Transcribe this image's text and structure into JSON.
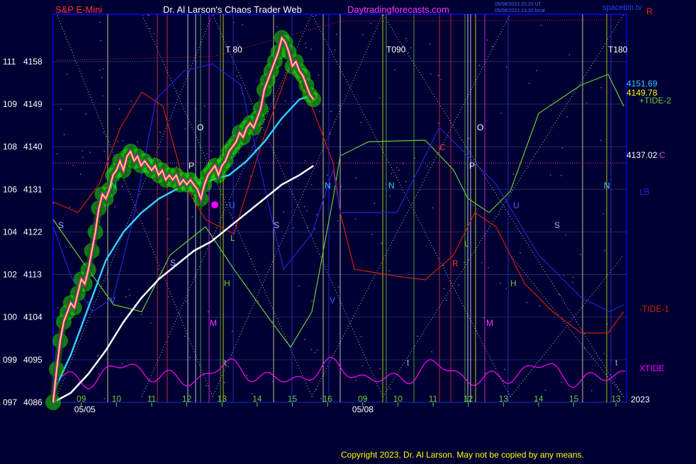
{
  "header": {
    "left_title": "S&P E-Mini",
    "center_title": "Dr. Al Larson's Chaos Trader Web",
    "site": "Daytradingforecasts.com",
    "timestamp_1": "05/08/2023 20:20 UT",
    "timestamp_2": "05/08/2023 13:20 local",
    "corner_right": "R",
    "corner_site": "spacetim.tv"
  },
  "footer": {
    "copyright": "Copyright 2023, Dr. Al Larson. May not be copied by any means."
  },
  "colors": {
    "background": "#000033",
    "plot_border": "#0000ff",
    "price": "#ffff00",
    "price_inner": "#ff00ff",
    "price_glow": "#22dd00",
    "cyan_ma": "#33ccff",
    "white_ma": "#ffffff",
    "tide2": "#66cc33",
    "tide1": "#cc2200",
    "xtide": "#ff00ff",
    "lb": "#2222dd",
    "c_line": "#cc44cc"
  },
  "chart_data": {
    "type": "line",
    "title": "S&P E-Mini",
    "y_tick_labels": [
      {
        "left": "097",
        "price": 4086
      },
      {
        "left": "099",
        "price": 4095
      },
      {
        "left": "100",
        "price": 4104
      },
      {
        "left": "102",
        "price": 4113
      },
      {
        "left": "104",
        "price": 4122
      },
      {
        "left": "106",
        "price": 4131
      },
      {
        "left": "108",
        "price": 4140
      },
      {
        "left": "109",
        "price": 4149
      },
      {
        "left": "111",
        "price": 4158
      }
    ],
    "y_range": [
      4086,
      4168
    ],
    "x_ticks": [
      {
        "label": "09",
        "t": 0.3
      },
      {
        "label": "10",
        "t": 1.3
      },
      {
        "label": "11",
        "t": 2.3
      },
      {
        "label": "12",
        "t": 3.3
      },
      {
        "label": "13",
        "t": 4.3
      },
      {
        "label": "14",
        "t": 5.3
      },
      {
        "label": "15",
        "t": 6.3
      },
      {
        "label": "16",
        "t": 7.3
      },
      {
        "label": "09",
        "t": 8.3
      },
      {
        "label": "10",
        "t": 9.3
      },
      {
        "label": "11",
        "t": 10.3
      },
      {
        "label": "12",
        "t": 11.3
      },
      {
        "label": "13",
        "t": 12.3
      },
      {
        "label": "14",
        "t": 13.3
      },
      {
        "label": "15",
        "t": 14.3
      },
      {
        "label": "13",
        "t": 15.5
      }
    ],
    "x_range": [
      -0.5,
      15.8
    ],
    "date_labels": [
      {
        "label": "05/05",
        "t": 0.0
      },
      {
        "label": "05/08",
        "t": 7.9
      }
    ],
    "year_label": "2023",
    "price_series": {
      "name": "S&P E-Mini",
      "points": [
        [
          -0.5,
          4086
        ],
        [
          -0.4,
          4093
        ],
        [
          -0.3,
          4099
        ],
        [
          -0.2,
          4103
        ],
        [
          -0.1,
          4105
        ],
        [
          0.0,
          4107
        ],
        [
          0.1,
          4106
        ],
        [
          0.2,
          4109
        ],
        [
          0.3,
          4112
        ],
        [
          0.4,
          4111
        ],
        [
          0.5,
          4114
        ],
        [
          0.6,
          4118
        ],
        [
          0.7,
          4122
        ],
        [
          0.8,
          4127
        ],
        [
          0.9,
          4130
        ],
        [
          1.0,
          4129
        ],
        [
          1.1,
          4131
        ],
        [
          1.2,
          4134
        ],
        [
          1.3,
          4135
        ],
        [
          1.4,
          4137
        ],
        [
          1.5,
          4135
        ],
        [
          1.6,
          4138
        ],
        [
          1.7,
          4139
        ],
        [
          1.8,
          4137
        ],
        [
          1.9,
          4138
        ],
        [
          2.0,
          4136
        ],
        [
          2.1,
          4137
        ],
        [
          2.2,
          4136
        ],
        [
          2.3,
          4135
        ],
        [
          2.4,
          4136
        ],
        [
          2.5,
          4134
        ],
        [
          2.6,
          4135
        ],
        [
          2.7,
          4133
        ],
        [
          2.8,
          4134
        ],
        [
          2.9,
          4133
        ],
        [
          3.0,
          4134
        ],
        [
          3.1,
          4132
        ],
        [
          3.2,
          4133
        ],
        [
          3.3,
          4132
        ],
        [
          3.4,
          4133
        ],
        [
          3.5,
          4132
        ],
        [
          3.6,
          4131
        ],
        [
          3.7,
          4129
        ],
        [
          3.8,
          4132
        ],
        [
          3.9,
          4134
        ],
        [
          4.0,
          4135
        ],
        [
          4.1,
          4136
        ],
        [
          4.2,
          4134
        ],
        [
          4.3,
          4136
        ],
        [
          4.4,
          4137
        ],
        [
          4.5,
          4139
        ],
        [
          4.6,
          4140
        ],
        [
          4.7,
          4141
        ],
        [
          4.8,
          4143
        ],
        [
          4.9,
          4142
        ],
        [
          5.0,
          4144
        ],
        [
          5.1,
          4145
        ],
        [
          5.2,
          4144
        ],
        [
          5.3,
          4146
        ],
        [
          5.4,
          4148
        ],
        [
          5.5,
          4152
        ],
        [
          5.6,
          4154
        ],
        [
          5.7,
          4156
        ],
        [
          5.8,
          4158
        ],
        [
          5.9,
          4160
        ],
        [
          6.0,
          4163
        ],
        [
          6.1,
          4162
        ],
        [
          6.2,
          4160
        ],
        [
          6.3,
          4157
        ],
        [
          6.4,
          4158
        ],
        [
          6.5,
          4156
        ],
        [
          6.6,
          4155
        ],
        [
          6.7,
          4153
        ],
        [
          6.8,
          4151
        ],
        [
          6.9,
          4150
        ]
      ]
    },
    "mini_series": [
      {
        "name": "cyan_ma",
        "points": [
          [
            -0.5,
            4088
          ],
          [
            0,
            4096
          ],
          [
            0.5,
            4106
          ],
          [
            1,
            4116
          ],
          [
            1.5,
            4122
          ],
          [
            2,
            4126
          ],
          [
            2.5,
            4129
          ],
          [
            3,
            4131
          ],
          [
            3.5,
            4132
          ],
          [
            4,
            4133
          ],
          [
            4.5,
            4134
          ],
          [
            5,
            4137
          ],
          [
            5.5,
            4141
          ],
          [
            6,
            4146
          ],
          [
            6.5,
            4150
          ],
          [
            6.9,
            4151
          ]
        ]
      },
      {
        "name": "white_ma",
        "points": [
          [
            -0.5,
            4086
          ],
          [
            0,
            4088
          ],
          [
            0.5,
            4092
          ],
          [
            1,
            4097
          ],
          [
            1.5,
            4103
          ],
          [
            2,
            4108
          ],
          [
            2.5,
            4112
          ],
          [
            3,
            4115
          ],
          [
            3.5,
            4118
          ],
          [
            4,
            4120
          ],
          [
            4.5,
            4123
          ],
          [
            5,
            4126
          ],
          [
            5.5,
            4129
          ],
          [
            6,
            4132
          ],
          [
            6.5,
            4134
          ],
          [
            6.9,
            4136
          ]
        ]
      }
    ],
    "right_labels": [
      {
        "label": "4151.69",
        "color": "#33ccff"
      },
      {
        "label": "4149.78",
        "color": "#ffff00"
      },
      {
        "label": "+TIDE-2",
        "color": "#66cc33"
      },
      {
        "label": "4137.02",
        "color": "#ffffff"
      },
      {
        "label": "C",
        "color": "#cc44cc"
      },
      {
        "label": "LB",
        "color": "#2222dd"
      },
      {
        "label": "-TIDE-1",
        "color": "#cc2200"
      },
      {
        "label": "XTIDE",
        "color": "#ff00ff"
      }
    ],
    "top_markers": [
      "T 80",
      "T090",
      "T180"
    ],
    "chart_letters": [
      "O",
      "O",
      "P",
      "P",
      "N",
      "N",
      "N",
      "N",
      "S",
      "S",
      "S",
      "S",
      "H",
      "H",
      "M",
      "M",
      "R",
      "C",
      "V",
      "V",
      "U",
      "U",
      "t",
      "t",
      "t",
      "L",
      "L"
    ],
    "grid": true,
    "legend": "right"
  }
}
